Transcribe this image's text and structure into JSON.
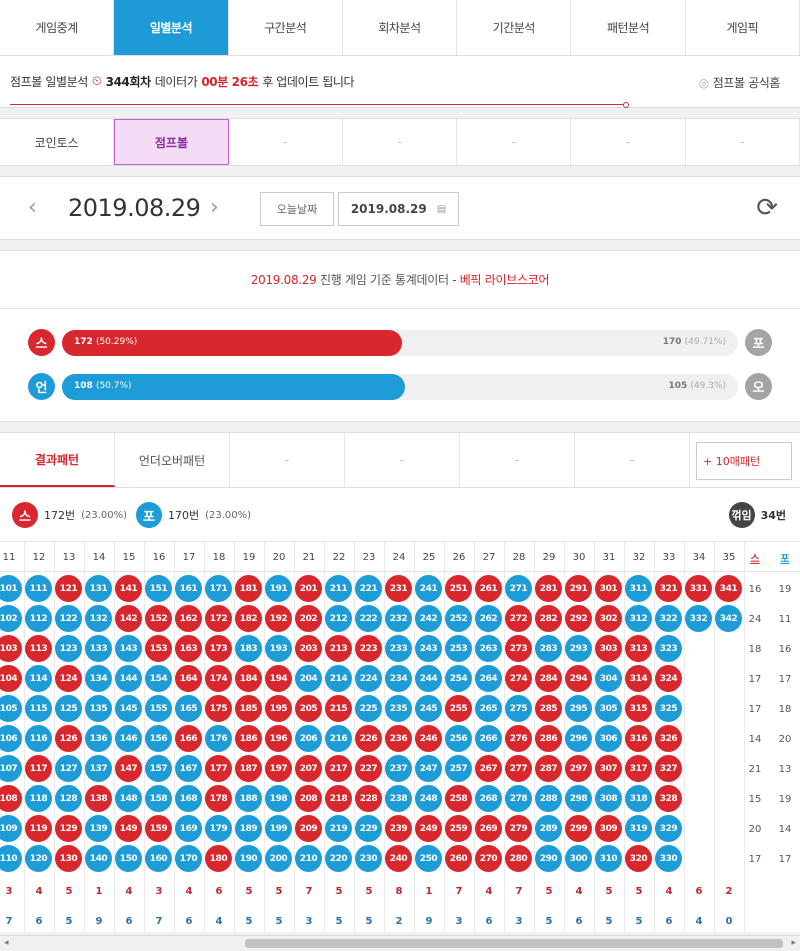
{
  "nav": [
    "게임중계",
    "일별분석",
    "구간분석",
    "회차분석",
    "기간분석",
    "패턴분석",
    "게임픽"
  ],
  "nav_active": 1,
  "info": {
    "title": "점프볼 일별분석",
    "round": "344회차",
    "mid": "데이터가",
    "timer": "00분 26초",
    "suffix": "후 업데이트 됩니다",
    "official": "점프볼 공식홈"
  },
  "game_tabs": [
    "코인토스",
    "점프볼",
    "-",
    "-",
    "-",
    "-",
    "-"
  ],
  "game_active": 1,
  "date": {
    "main": "2019.08.29",
    "today_btn": "오늘날짜",
    "input": "2019.08.29"
  },
  "stats": {
    "head_date": "2019.08.29",
    "head_text": " 진행 게임 기준 통계데이터 - ",
    "head_source": "베픽 라이브스코어",
    "rows": [
      {
        "left_label": "스",
        "left_count": "172",
        "left_pct": "(50.29%)",
        "right_count": "170",
        "right_pct": "(49.71%)",
        "right_label": "포",
        "fill": 0.5029,
        "color": "#d8282d"
      },
      {
        "left_label": "언",
        "left_count": "108",
        "left_pct": "(50.7%)",
        "right_count": "105",
        "right_pct": "(49.3%)",
        "right_label": "오",
        "fill": 0.507,
        "color": "#1d9cd8"
      }
    ]
  },
  "pattern_tabs": [
    "결과패턴",
    "언더오버패턴",
    "-",
    "-",
    "-",
    "-"
  ],
  "pattern_ten": "+ 10매패턴",
  "legend": {
    "s_label": "스",
    "s_count": "172번",
    "s_pct": "(23.00%)",
    "p_label": "포",
    "p_count": "170번",
    "p_pct": "(23.00%)",
    "k_label": "꺾임",
    "k_count": "34번"
  },
  "grid": {
    "col_headers": [
      "11",
      "12",
      "13",
      "14",
      "15",
      "16",
      "17",
      "18",
      "19",
      "20",
      "21",
      "22",
      "23",
      "24",
      "25",
      "26",
      "27",
      "28",
      "29",
      "30",
      "31",
      "32",
      "33",
      "34",
      "35"
    ],
    "side_headers": [
      "스",
      "포"
    ],
    "colors": [
      "bbrbrbbbrbrbbrbrrbrrrbrrr",
      "bbbbrrrrrrrbbbbbbrrrrbbbb",
      "rrbbbrrrbbrrrbbbbrbbrrb",
      "rbrbbbrrrrbbbbbbbrrrbrr",
      "bbbbbbbrrrrrbbbrbbrbbrb",
      "bbrbbbrbrrbbrrrbbrrbbrr",
      "brbbrbbrrrrrrbbbrrrrrrr",
      "rbbrbbbrbbrrrbbrbbbbbbr",
      "brrbrrbbbbrbbrrrrrbrrbb",
      "bbrbbbbrbbbbbrbrrrbbbrb"
    ],
    "side_values": [
      [
        "16",
        "19"
      ],
      [
        "24",
        "11"
      ],
      [
        "18",
        "16"
      ],
      [
        "17",
        "17"
      ],
      [
        "17",
        "18"
      ],
      [
        "14",
        "20"
      ],
      [
        "21",
        "13"
      ],
      [
        "15",
        "19"
      ],
      [
        "20",
        "14"
      ],
      [
        "17",
        "17"
      ]
    ],
    "count_row_red": [
      "3",
      "4",
      "5",
      "1",
      "4",
      "3",
      "4",
      "6",
      "5",
      "5",
      "7",
      "5",
      "5",
      "8",
      "1",
      "7",
      "4",
      "7",
      "5",
      "4",
      "5",
      "5",
      "4",
      "6",
      "2"
    ],
    "count_row_blue": [
      "7",
      "6",
      "5",
      "9",
      "6",
      "7",
      "6",
      "4",
      "5",
      "5",
      "3",
      "5",
      "5",
      "2",
      "9",
      "3",
      "6",
      "3",
      "5",
      "6",
      "5",
      "5",
      "6",
      "4",
      "0"
    ]
  },
  "colors": {
    "red": "#d8282d",
    "blue": "#1d9cd8",
    "accent": "#1e9bd7",
    "purple": "#8b2e9d"
  }
}
